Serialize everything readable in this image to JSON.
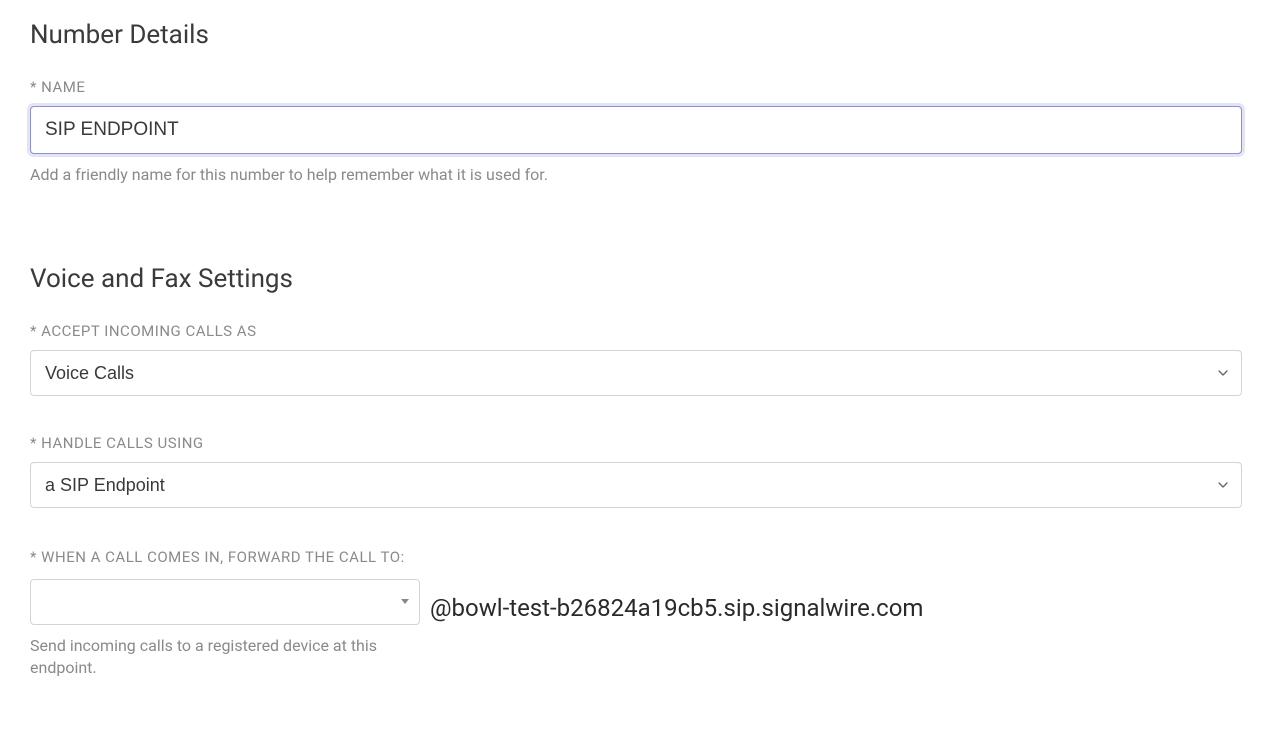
{
  "numberDetails": {
    "title": "Number Details",
    "nameLabel": "* NAME",
    "nameValue": "SIP ENDPOINT",
    "nameHelp": "Add a friendly name for this number to help remember what it is used for."
  },
  "voiceFax": {
    "title": "Voice and Fax Settings",
    "acceptLabel": "* ACCEPT INCOMING CALLS AS",
    "acceptValue": "Voice Calls",
    "handleLabel": "* HANDLE CALLS USING",
    "handleValue": "a SIP Endpoint",
    "forwardLabel": "* WHEN A CALL COMES IN, FORWARD THE CALL TO:",
    "forwardHelp": "Send incoming calls to a registered device at this endpoint.",
    "sipSuffix": "@bowl-test-b26824a19cb5.sip.signalwire.com"
  }
}
